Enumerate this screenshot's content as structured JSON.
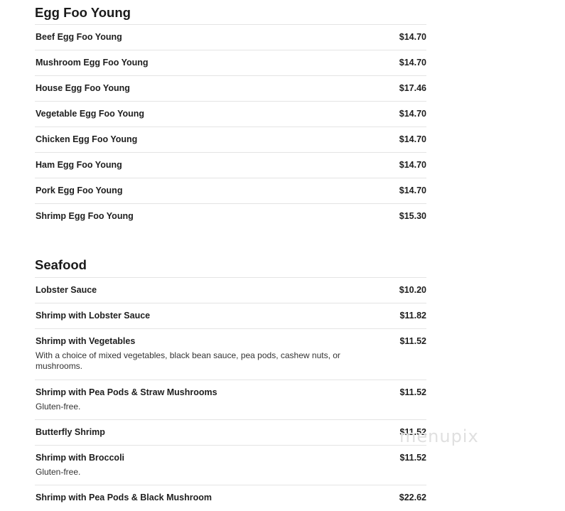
{
  "sections": [
    {
      "title": "Egg Foo Young",
      "items": [
        {
          "name": "Beef Egg Foo Young",
          "price": "$14.70"
        },
        {
          "name": "Mushroom Egg Foo Young",
          "price": "$14.70"
        },
        {
          "name": "House Egg Foo Young",
          "price": "$17.46"
        },
        {
          "name": "Vegetable Egg Foo Young",
          "price": "$14.70"
        },
        {
          "name": "Chicken Egg Foo Young",
          "price": "$14.70"
        },
        {
          "name": "Ham Egg Foo Young",
          "price": "$14.70"
        },
        {
          "name": "Pork Egg Foo Young",
          "price": "$14.70"
        },
        {
          "name": "Shrimp Egg Foo Young",
          "price": "$15.30"
        }
      ]
    },
    {
      "title": "Seafood",
      "items": [
        {
          "name": "Lobster Sauce",
          "price": "$10.20"
        },
        {
          "name": "Shrimp with Lobster Sauce",
          "price": "$11.82"
        },
        {
          "name": "Shrimp with Vegetables",
          "price": "$11.52",
          "description": "With a choice of mixed vegetables, black bean sauce, pea pods, cashew nuts, or mushrooms."
        },
        {
          "name": "Shrimp with Pea Pods & Straw Mushrooms",
          "price": "$11.52",
          "description": "Gluten-free."
        },
        {
          "name": "Butterfly Shrimp",
          "price": "$11.52"
        },
        {
          "name": "Shrimp with Broccoli",
          "price": "$11.52",
          "description": "Gluten-free."
        },
        {
          "name": "Shrimp with Pea Pods & Black Mushroom",
          "price": "$22.62"
        }
      ]
    }
  ],
  "watermark": "menupix"
}
